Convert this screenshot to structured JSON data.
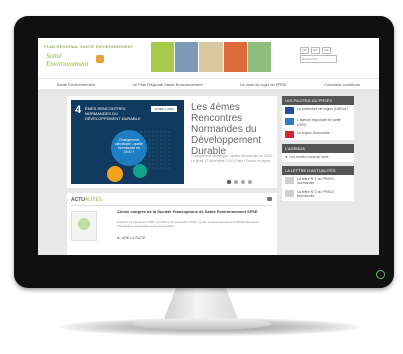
{
  "header": {
    "logo_line1": "PLAN RÉGIONAL SANTÉ ENVIRONNEMENT",
    "logo_line2": "Santé",
    "logo_line3": "Environnement",
    "lang": [
      "FR",
      "EN",
      "DE"
    ],
    "search_placeholder": "Rechercher"
  },
  "nav": {
    "items": [
      "Santé Environnement",
      "Le Plan Régional Santé Environnement",
      "Le mois du sujet du PRSE",
      "Comment contribuer"
    ]
  },
  "slider": {
    "badge_num": "4",
    "badge_text": "ÈMES RENCONTRES NORMANDES DU DÉVELOPPEMENT DURABLE",
    "date_tag": "17 DEC | 2020",
    "circle_text": "Changement climatique : quelle Normandie en 2100 ?",
    "title": "Les 4èmes Rencontres Normandes du Développement Durable",
    "desc": "Changement climatique : quelle Normandie en 2100 ? Le jeudi 17 décembre 2020 (Visio / Forum en ligne)",
    "page_count": 4,
    "active_page": 1
  },
  "actu": {
    "heading_a": "ACTU",
    "heading_b": "ALITÉS",
    "title": "11ème congrès de la Société Francophone de Santé Environnement SFSE",
    "sub": "publié le 14 septembre 2020 (modifié le 30 septembre 2020) Le 11e congrès annuel de la SFSE aborde les thématiques de la santé environnementale",
    "more": "LIRE LA SUITE"
  },
  "side": {
    "pilots_header": "LES PILOTES DU PRSE3",
    "pilots": [
      "La préfecture de région (DREAL)",
      "L'agence régionale de santé (ARS)",
      "La région Normandie"
    ],
    "agenda_header": "L'AGENDA",
    "agenda_items": [
      "Les rendez-vous du mois"
    ],
    "letter_header": "LA LETTRE D'ACTUALITÉS",
    "letter_items": [
      "La lettre N°1 du PRSE3 Normandie",
      "La lettre N°2 du PRSE3 Normandie"
    ]
  },
  "colors": {
    "accent": "#8bbd2e",
    "slide_bg": "#123a5e",
    "box_header": "#555555"
  }
}
